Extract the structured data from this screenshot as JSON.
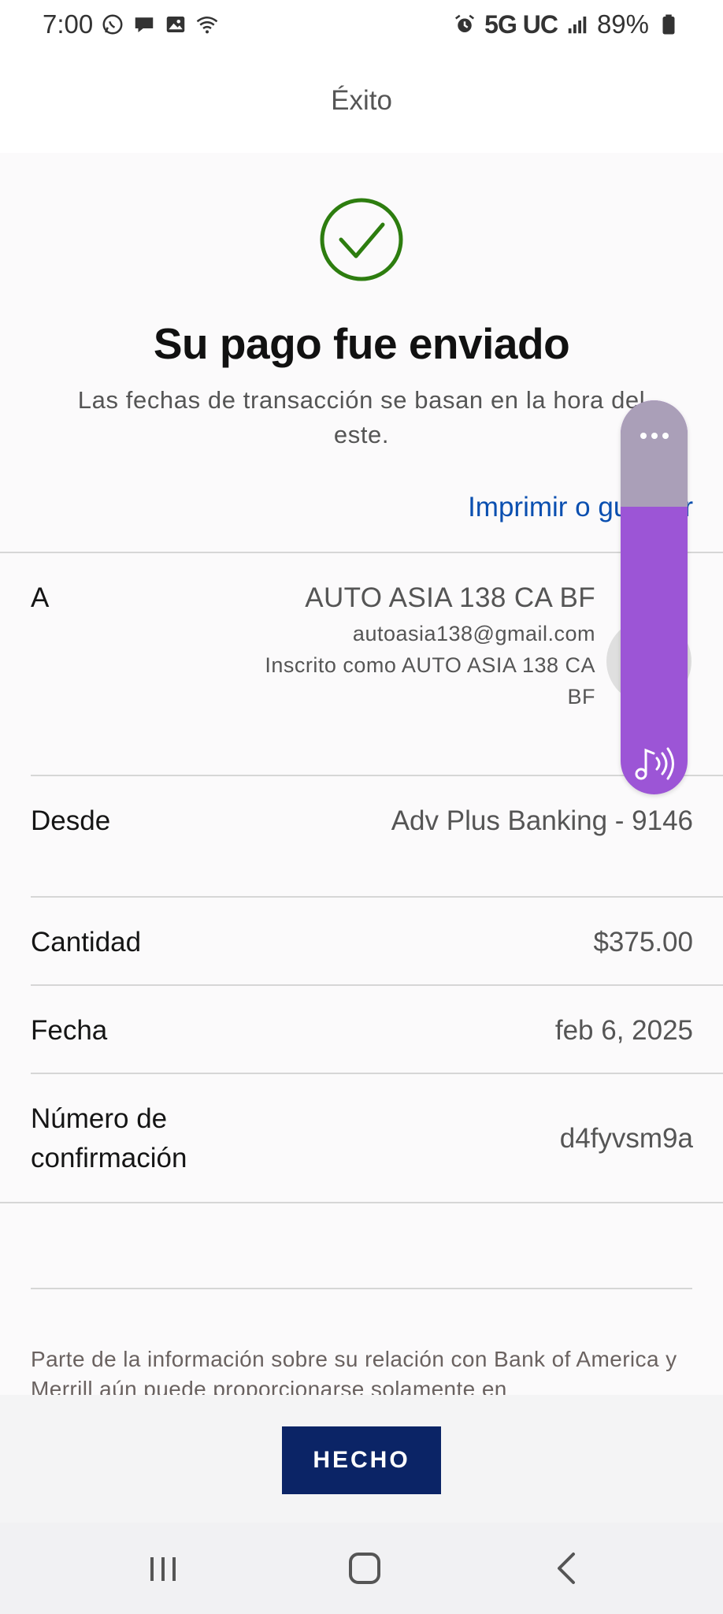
{
  "status_bar": {
    "time": "7:00",
    "network": "5G UC",
    "battery": "89%",
    "left_icons": [
      "whatsapp-icon",
      "chat-bubble-icon",
      "gallery-icon",
      "wifi-icon"
    ],
    "right_icons": [
      "alarm-icon",
      "signal-icon",
      "battery-icon"
    ]
  },
  "header": {
    "title": "Éxito"
  },
  "success": {
    "icon": "check-circle-icon",
    "icon_color": "#2d7d0f",
    "title": "Su pago fue enviado",
    "subtitle": "Las fechas de transacción se basan en la hora del este."
  },
  "print_link": "Imprimir o guardar",
  "details": {
    "to": {
      "label": "A",
      "name": "AUTO ASIA 138 CA BF",
      "email": "autoasia138@gmail.com",
      "enrolled": "Inscrito como AUTO ASIA 138 CA BF"
    },
    "from": {
      "label": "Desde",
      "value": "Adv Plus Banking - 9146"
    },
    "amount": {
      "label": "Cantidad",
      "value": "$375.00"
    },
    "date": {
      "label": "Fecha",
      "value": "feb 6, 2025"
    },
    "confirmation": {
      "label": "Número de confirmación",
      "value": "d4fyvsm9a"
    }
  },
  "disclaimer": "Parte de la información sobre su relación con Bank of America y Merrill aún puede proporcionarse solamente en",
  "footer": {
    "done_label": "HECHO",
    "button_color": "#0b2466"
  },
  "volume_overlay": {
    "level": 0.73,
    "color": "#9c55d6",
    "icons": [
      "more-options-icon",
      "media-volume-icon"
    ]
  },
  "nav_bar": {
    "buttons": [
      "recent-apps-icon",
      "home-icon",
      "back-icon"
    ]
  }
}
